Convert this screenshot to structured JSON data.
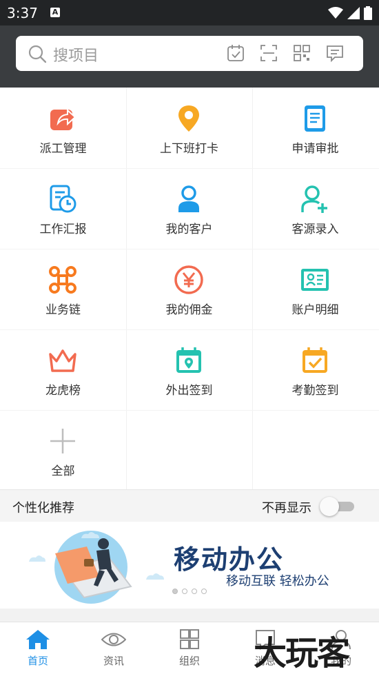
{
  "status_bar": {
    "time": "3:37",
    "notification_icon": "A"
  },
  "search": {
    "placeholder": "搜项目"
  },
  "grid": {
    "items": [
      {
        "label": "派工管理",
        "icon": "share-box-icon",
        "color": "#f26b50"
      },
      {
        "label": "上下班打卡",
        "icon": "location-pin-icon",
        "color": "#f7a823"
      },
      {
        "label": "申请审批",
        "icon": "document-icon",
        "color": "#1e9be8"
      },
      {
        "label": "工作汇报",
        "icon": "report-clock-icon",
        "color": "#1e9be8"
      },
      {
        "label": "我的客户",
        "icon": "person-icon",
        "color": "#1e9be8"
      },
      {
        "label": "客源录入",
        "icon": "add-person-icon",
        "color": "#24c2b0"
      },
      {
        "label": "业务链",
        "icon": "command-icon",
        "color": "#f77a1f"
      },
      {
        "label": "我的佣金",
        "icon": "yen-icon",
        "color": "#f26b50"
      },
      {
        "label": "账户明细",
        "icon": "id-card-icon",
        "color": "#24c2b0"
      },
      {
        "label": "龙虎榜",
        "icon": "crown-icon",
        "color": "#f26b50"
      },
      {
        "label": "外出签到",
        "icon": "calendar-pin-icon",
        "color": "#24c2b0"
      },
      {
        "label": "考勤签到",
        "icon": "calendar-check-icon",
        "color": "#f7a823"
      },
      {
        "label": "全部",
        "icon": "plus-icon",
        "color": "#bdbdbd"
      }
    ]
  },
  "recommend": {
    "title": "个性化推荐",
    "hide_label": "不再显示",
    "toggle_on": false
  },
  "banner": {
    "title": "移动办公",
    "subtitle": "移动互联 轻松办公",
    "page_count": 4,
    "active_page": 0
  },
  "tabbar": {
    "tabs": [
      {
        "label": "首页",
        "icon": "home-icon",
        "active": true
      },
      {
        "label": "资讯",
        "icon": "eye-icon",
        "active": false
      },
      {
        "label": "组织",
        "icon": "grid-icon",
        "active": false
      },
      {
        "label": "消息",
        "icon": "message-icon",
        "active": false
      },
      {
        "label": "我的",
        "icon": "profile-icon",
        "active": false
      }
    ]
  },
  "watermark": "大玩客",
  "colors": {
    "accent": "#1e8fe5",
    "header": "#3a3d40",
    "banner_text": "#1d3f72"
  }
}
